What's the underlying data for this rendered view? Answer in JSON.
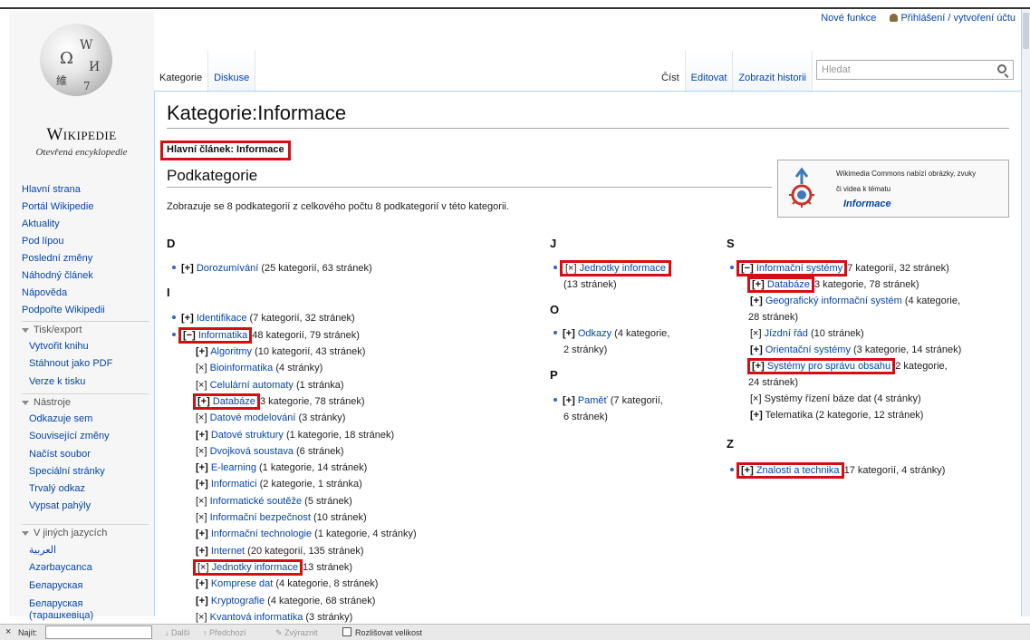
{
  "header": {
    "new_features": "Nové funkce",
    "login": "Přihlášení / vytvoření účtu",
    "tabs_left": [
      "Kategorie",
      "Diskuse"
    ],
    "tabs_right": [
      "Číst",
      "Editovat",
      "Zobrazit historii"
    ],
    "search_placeholder": "Hledat"
  },
  "sidebar": {
    "title": "Wikipedie",
    "subtitle": "Otevřená encyklopedie",
    "nav": [
      "Hlavní strana",
      "Portál Wikipedie",
      "Aktuality",
      "Pod lípou",
      "Poslední změny",
      "Náhodný článek",
      "Nápověda",
      "Podpořte Wikipedii"
    ],
    "print_head": "Tisk/export",
    "print_items": [
      "Vytvořit knihu",
      "Stáhnout jako PDF",
      "Verze k tisku"
    ],
    "tools_head": "Nástroje",
    "tools_items": [
      "Odkazuje sem",
      "Související změny",
      "Načíst soubor",
      "Speciální stránky",
      "Trvalý odkaz",
      "Vypsat pahýly"
    ],
    "lang_head": "V jiných jazycích",
    "lang_items": [
      "العربية",
      "Azərbaycanca",
      "Беларуская",
      "Беларуская",
      "(тарашкевіца)"
    ]
  },
  "content": {
    "title": "Kategorie:Informace",
    "main_article_prefix": "Hlavní článek:",
    "main_article_link": "Informace",
    "subcat_heading": "Podkategorie",
    "subcat_count": "Zobrazuje se 8 podkategorií z celkového počtu 8 podkategorií v této kategorii.",
    "commons": {
      "line1": "Wikimedia Commons nabízí obrázky, zvuky",
      "line2": "či videa k tématu",
      "link": "Informace"
    }
  },
  "columns": {
    "d": {
      "letter_d": "D",
      "dorozumivani": {
        "sym": "[+]",
        "link": "Dorozumívání",
        "info": " (25 kategorií, 63 stránek)"
      },
      "letter_i": "I",
      "identifikace": {
        "sym": "[+]",
        "link": "Identifikace",
        "info": " (7 kategorií, 32 stránek)"
      },
      "informatika": {
        "sym": "[−]",
        "link": "Informatika",
        "info": " 48 kategorií, 79 stránek)"
      },
      "children": [
        {
          "sym": "[+]",
          "link": "Algoritmy",
          "info": " (10 kategorií, 43 stránek)"
        },
        {
          "sym": "[×]",
          "link": "Bioinformatika",
          "info": " (4 stránky)"
        },
        {
          "sym": "[×]",
          "link": "Celulární automaty",
          "info": " (1 stránka)"
        },
        {
          "sym": "[+]",
          "link": "Databáze",
          "info": " 3 kategorie, 78 stránek)"
        },
        {
          "sym": "[×]",
          "link": "Datové modelování",
          "info": " (3 stránky)"
        },
        {
          "sym": "[+]",
          "link": "Datové struktury",
          "info": " (1 kategorie, 18 stránek)"
        },
        {
          "sym": "[×]",
          "link": "Dvojková soustava",
          "info": " (6 stránek)"
        },
        {
          "sym": "[+]",
          "link": "E-learning",
          "info": " (1 kategorie, 14 stránek)"
        },
        {
          "sym": "[+]",
          "link": "Informatici",
          "info": " (2 kategorie, 1 stránka)"
        },
        {
          "sym": "[×]",
          "link": "Informatické soutěže",
          "info": " (5 stránek)"
        },
        {
          "sym": "[×]",
          "link": "Informační bezpečnost",
          "info": " (10 stránek)"
        },
        {
          "sym": "[+]",
          "link": "Informační technologie",
          "info": " (1 kategorie, 4 stránky)"
        },
        {
          "sym": "[+]",
          "link": "Internet",
          "info": " (20 kategorií, 135 stránek)"
        },
        {
          "sym": "[×]",
          "link": "Jednotky informace",
          "info": " 13 stránek)"
        },
        {
          "sym": "[+]",
          "link": "Komprese dat",
          "info": " (4 kategorie, 8 stránek)"
        },
        {
          "sym": "[+]",
          "link": "Kryptografie",
          "info": " (4 kategorie, 68 stránek)"
        },
        {
          "sym": "[×]",
          "link": "Kvantová informatika",
          "info": " (3 stránky)"
        }
      ]
    },
    "j": {
      "letter_j": "J",
      "jednotky": {
        "sym": "[×]",
        "link": "Jednotky informace",
        "info": "(13 stránek)"
      },
      "letter_o": "O",
      "odkazy": {
        "sym": "[+]",
        "link": "Odkazy",
        "info1": " (4 kategorie,",
        "info2": "2 stránky)"
      },
      "letter_p": "P",
      "pamet": {
        "sym": "[+]",
        "link": "Paměť",
        "info1": " (7 kategorií,",
        "info2": "6 stránek)"
      }
    },
    "s": {
      "letter_s": "S",
      "is": {
        "sym": "[−]",
        "link": "Informační systémy",
        "info": " 7 kategorií, 32 stránek)"
      },
      "children": [
        {
          "sym": "[+]",
          "link": "Databáze",
          "info": " 3 kategorie, 78 stránek)"
        },
        {
          "sym": "[+]",
          "link": "Geografický informační systém",
          "info": " (4 kategorie,",
          "info2": "28 stránek)"
        },
        {
          "sym": "[×]",
          "link": "Jízdní řád",
          "info": " (10 stránek)"
        },
        {
          "sym": "[+]",
          "link": "Orientační systémy",
          "info": " (3 kategorie, 14 stránek)"
        },
        {
          "sym": "[+]",
          "link": "Systémy pro správu obsahu",
          "info": " 2 kategorie,",
          "info2": "24 stránek)"
        },
        {
          "sym": "[×]",
          "link": "",
          "text": "Systémy řízení báze dat (4 stránky)"
        },
        {
          "sym": "[+]",
          "link": "",
          "text": "Telematika (2 kategorie, 12 stránek)"
        }
      ],
      "letter_z": "Z",
      "znalosti": {
        "sym": "[+]",
        "link": "Znalosti a technika",
        "info": " 17 kategorií, 4 stránky)"
      }
    }
  },
  "findbar": {
    "label": "Najít:",
    "next": "Další",
    "prev": "Předchozí",
    "highlight": "Zvýraznit",
    "match_case": "Rozlišovat velikost"
  }
}
